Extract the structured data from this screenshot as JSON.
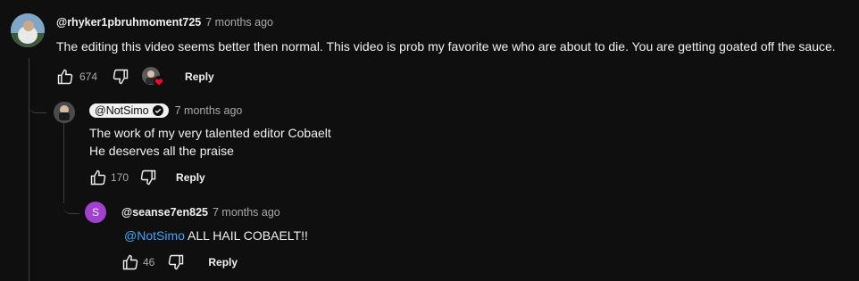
{
  "comment": {
    "author": "@rhyker1pbruhmoment725",
    "time": "7 months ago",
    "text": "The editing this video seems better then normal. This video is prob my favorite we who are about to die. You are getting goated off the sauce.",
    "likes": "674",
    "reply_label": "Reply"
  },
  "reply1": {
    "author": "@NotSimo",
    "time": "7 months ago",
    "line1": "The work of my very talented editor Cobaelt",
    "line2": "He deserves all the praise",
    "likes": "170",
    "reply_label": "Reply"
  },
  "reply2": {
    "avatar_letter": "S",
    "author": "@seanse7en825",
    "time": "7 months ago",
    "mention": "@NotSimo",
    "text": " ALL HAIL COBAELT!!",
    "likes": "46",
    "reply_label": "Reply"
  },
  "colors": {
    "background": "#0f0f0f",
    "link": "#3ea6ff",
    "avatar_purple": "#a142cf",
    "heart": "#ff0033"
  }
}
